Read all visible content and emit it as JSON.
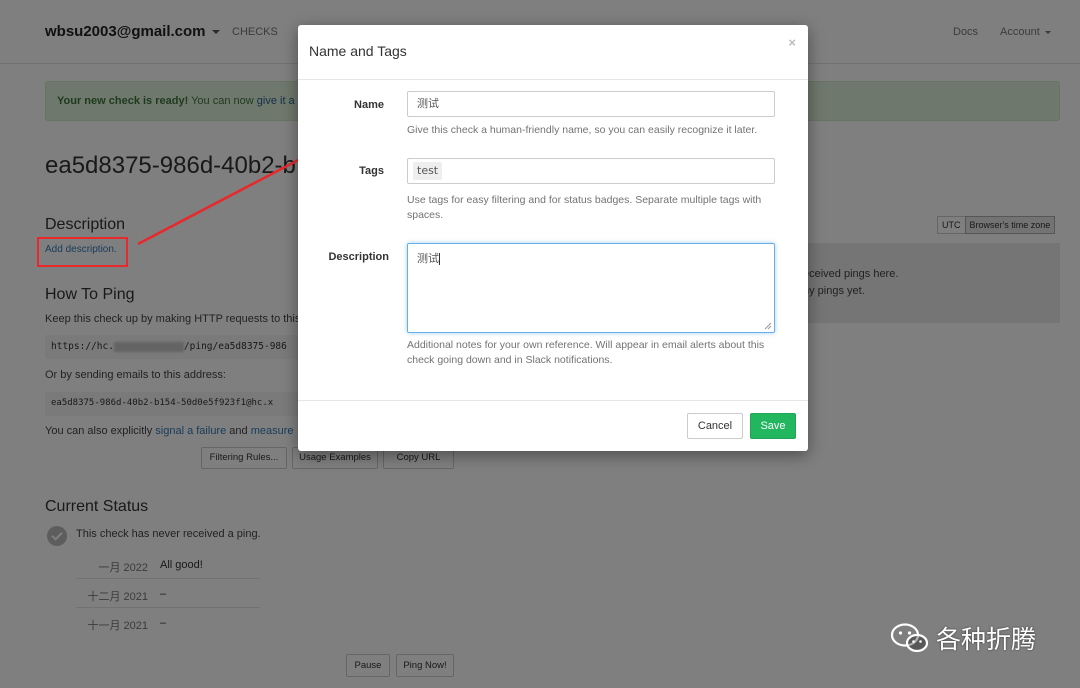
{
  "header": {
    "account_email": "wbsu2003@gmail.com",
    "nav_checks": "CHECKS",
    "nav_docs": "Docs",
    "nav_account": "Account"
  },
  "alert": {
    "strong": "Your new check is ready!",
    "text": " You can now ",
    "link": "give it a"
  },
  "check": {
    "title": "ea5d8375-986d-40b2-b"
  },
  "description": {
    "heading": "Description",
    "add_link": "Add description."
  },
  "how_to_ping": {
    "heading": "How To Ping",
    "intro": "Keep this check up by making HTTP requests to this",
    "url_prefix": "https://hc.",
    "url_suffix": "/ping/ea5d8375-986",
    "email_intro": "Or by sending emails to this address:",
    "email": "ea5d8375-986d-40b2-b154-50d0e5f923f1@hc.x",
    "signal_prefix": "You can also explicitly ",
    "signal_link": "signal a failure",
    "signal_mid": " and ",
    "signal_link2": "measure",
    "buttons": [
      "Filtering Rules...",
      "Usage Examples",
      "Copy URL"
    ]
  },
  "events": {
    "tz_utc": "UTC",
    "tz_browser": "Browser's time zone",
    "line1": "eceived pings here.",
    "line2": "ny pings yet."
  },
  "current_status": {
    "heading": "Current Status",
    "text": "This check has never received a ping.",
    "months": [
      {
        "month": "一月 2022",
        "status": "All good!"
      },
      {
        "month": "十二月 2021",
        "status": "–"
      },
      {
        "month": "十一月 2021",
        "status": "–"
      }
    ],
    "pause": "Pause",
    "ping_now": "Ping Now!"
  },
  "watermark": {
    "text": "各种折腾"
  },
  "modal": {
    "title": "Name and Tags",
    "close": "×",
    "name_label": "Name",
    "name_value": "测试",
    "name_help": "Give this check a human-friendly name, so you can easily recognize it later.",
    "tags_label": "Tags",
    "tags_value": "test",
    "tags_help": "Use tags for easy filtering and for status badges. Separate multiple tags with spaces.",
    "desc_label": "Description",
    "desc_value": "测试",
    "desc_help": "Additional notes for your own reference. Will appear in email alerts about this check going down and in Slack notifications.",
    "cancel": "Cancel",
    "save": "Save"
  },
  "colors": {
    "save_button": "#22b65f",
    "annotation_red": "#e8282b",
    "alert_bg": "#dff0d8",
    "link": "#337ab7"
  }
}
